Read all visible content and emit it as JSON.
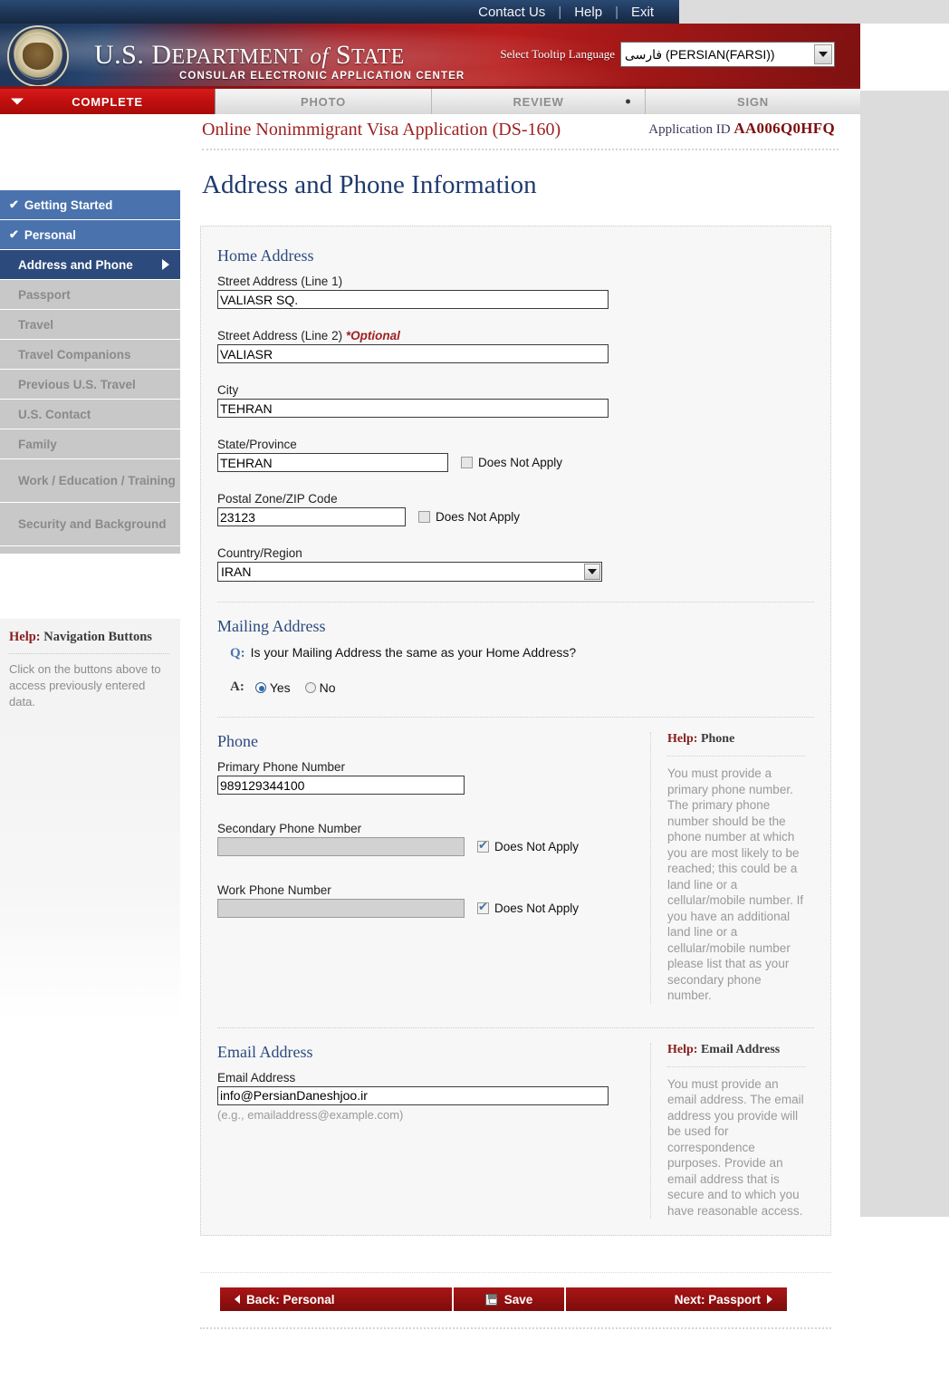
{
  "topbar": {
    "links": [
      "Contact Us",
      "Help",
      "Exit"
    ]
  },
  "banner": {
    "title_us": "U.S.",
    "title_department": "D",
    "title_department_rest": "EPARTMENT",
    "title_of": "of",
    "title_state": "S",
    "title_state_rest": "TATE",
    "subtitle": "CONSULAR ELECTRONIC APPLICATION CENTER",
    "language_label": "Select Tooltip Language",
    "language_value": "فارسی (PERSIAN(FARSI))"
  },
  "tabs": [
    {
      "label": "COMPLETE",
      "state": "active"
    },
    {
      "label": "PHOTO",
      "state": "inactive"
    },
    {
      "label": "REVIEW",
      "state": "inactive"
    },
    {
      "label": "SIGN",
      "state": "inactive"
    }
  ],
  "sidebar": {
    "items": [
      {
        "label": "Getting Started",
        "state": "done"
      },
      {
        "label": "Personal",
        "state": "done"
      },
      {
        "label": "Address and Phone",
        "state": "current"
      },
      {
        "label": "Passport",
        "state": "pending"
      },
      {
        "label": "Travel",
        "state": "pending"
      },
      {
        "label": "Travel Companions",
        "state": "pending"
      },
      {
        "label": "Previous U.S. Travel",
        "state": "pending"
      },
      {
        "label": "U.S. Contact",
        "state": "pending"
      },
      {
        "label": "Family",
        "state": "pending"
      },
      {
        "label": "Work / Education / Training",
        "state": "pending"
      },
      {
        "label": "Security and Background",
        "state": "pending"
      }
    ],
    "help": {
      "title_strong": "Help:",
      "title_rest": " Navigation Buttons",
      "body": "Click on the buttons above to access previously entered data."
    }
  },
  "header": {
    "app_title": "Online Nonimmigrant Visa Application (DS-160)",
    "app_id_label": "Application ID",
    "app_id_value": "AA006Q0HFQ",
    "page_title": "Address and Phone Information"
  },
  "home_address": {
    "section_title": "Home Address",
    "street1_label": "Street Address (Line 1)",
    "street1_value": "VALIASR SQ.",
    "street2_label": "Street Address (Line 2)",
    "street2_optional": "*Optional",
    "street2_value": "VALIASR",
    "city_label": "City",
    "city_value": "TEHRAN",
    "state_label": "State/Province",
    "state_value": "TEHRAN",
    "state_dna_label": "Does Not Apply",
    "postal_label": "Postal Zone/ZIP Code",
    "postal_value": "23123",
    "postal_dna_label": "Does Not Apply",
    "country_label": "Country/Region",
    "country_value": "IRAN"
  },
  "mailing_address": {
    "section_title": "Mailing Address",
    "q_mark": "Q:",
    "question": "Is your Mailing Address the same as your Home Address?",
    "a_mark": "A:",
    "yes_label": "Yes",
    "no_label": "No",
    "selected": "Yes"
  },
  "phone": {
    "section_title": "Phone",
    "primary_label": "Primary Phone Number",
    "primary_value": "989129344100",
    "secondary_label": "Secondary Phone Number",
    "secondary_value": "",
    "secondary_dna_label": "Does Not Apply",
    "work_label": "Work Phone Number",
    "work_value": "",
    "work_dna_label": "Does Not Apply",
    "help_title_strong": "Help:",
    "help_title_rest": " Phone",
    "help_body": "You must provide a primary phone number.  The primary phone number should be the phone number at which you are most likely to be reached; this could be a land line or a cellular/mobile number.  If you have an additional land line or a cellular/mobile number please list that as your secondary phone number."
  },
  "email": {
    "section_title": "Email Address",
    "field_label": "Email Address",
    "value": "info@PersianDaneshjoo.ir",
    "hint": "(e.g., emailaddress@example.com)",
    "help_title_strong": "Help:",
    "help_title_rest": " Email Address",
    "help_body": "You must provide an email address.  The email address you provide will be used for correspondence purposes.  Provide an email address that is secure and to which you have reasonable access."
  },
  "footer": {
    "back_label": "Back: Personal",
    "save_label": "Save",
    "next_label": "Next: Passport"
  },
  "colors": {
    "brand_red": "#a81717",
    "navy": "#1f3a6e",
    "nav_done": "#4a72ad",
    "nav_current": "#2c4a7c",
    "nav_pending": "#c8c8c8",
    "help_red": "#8a1c1c"
  }
}
